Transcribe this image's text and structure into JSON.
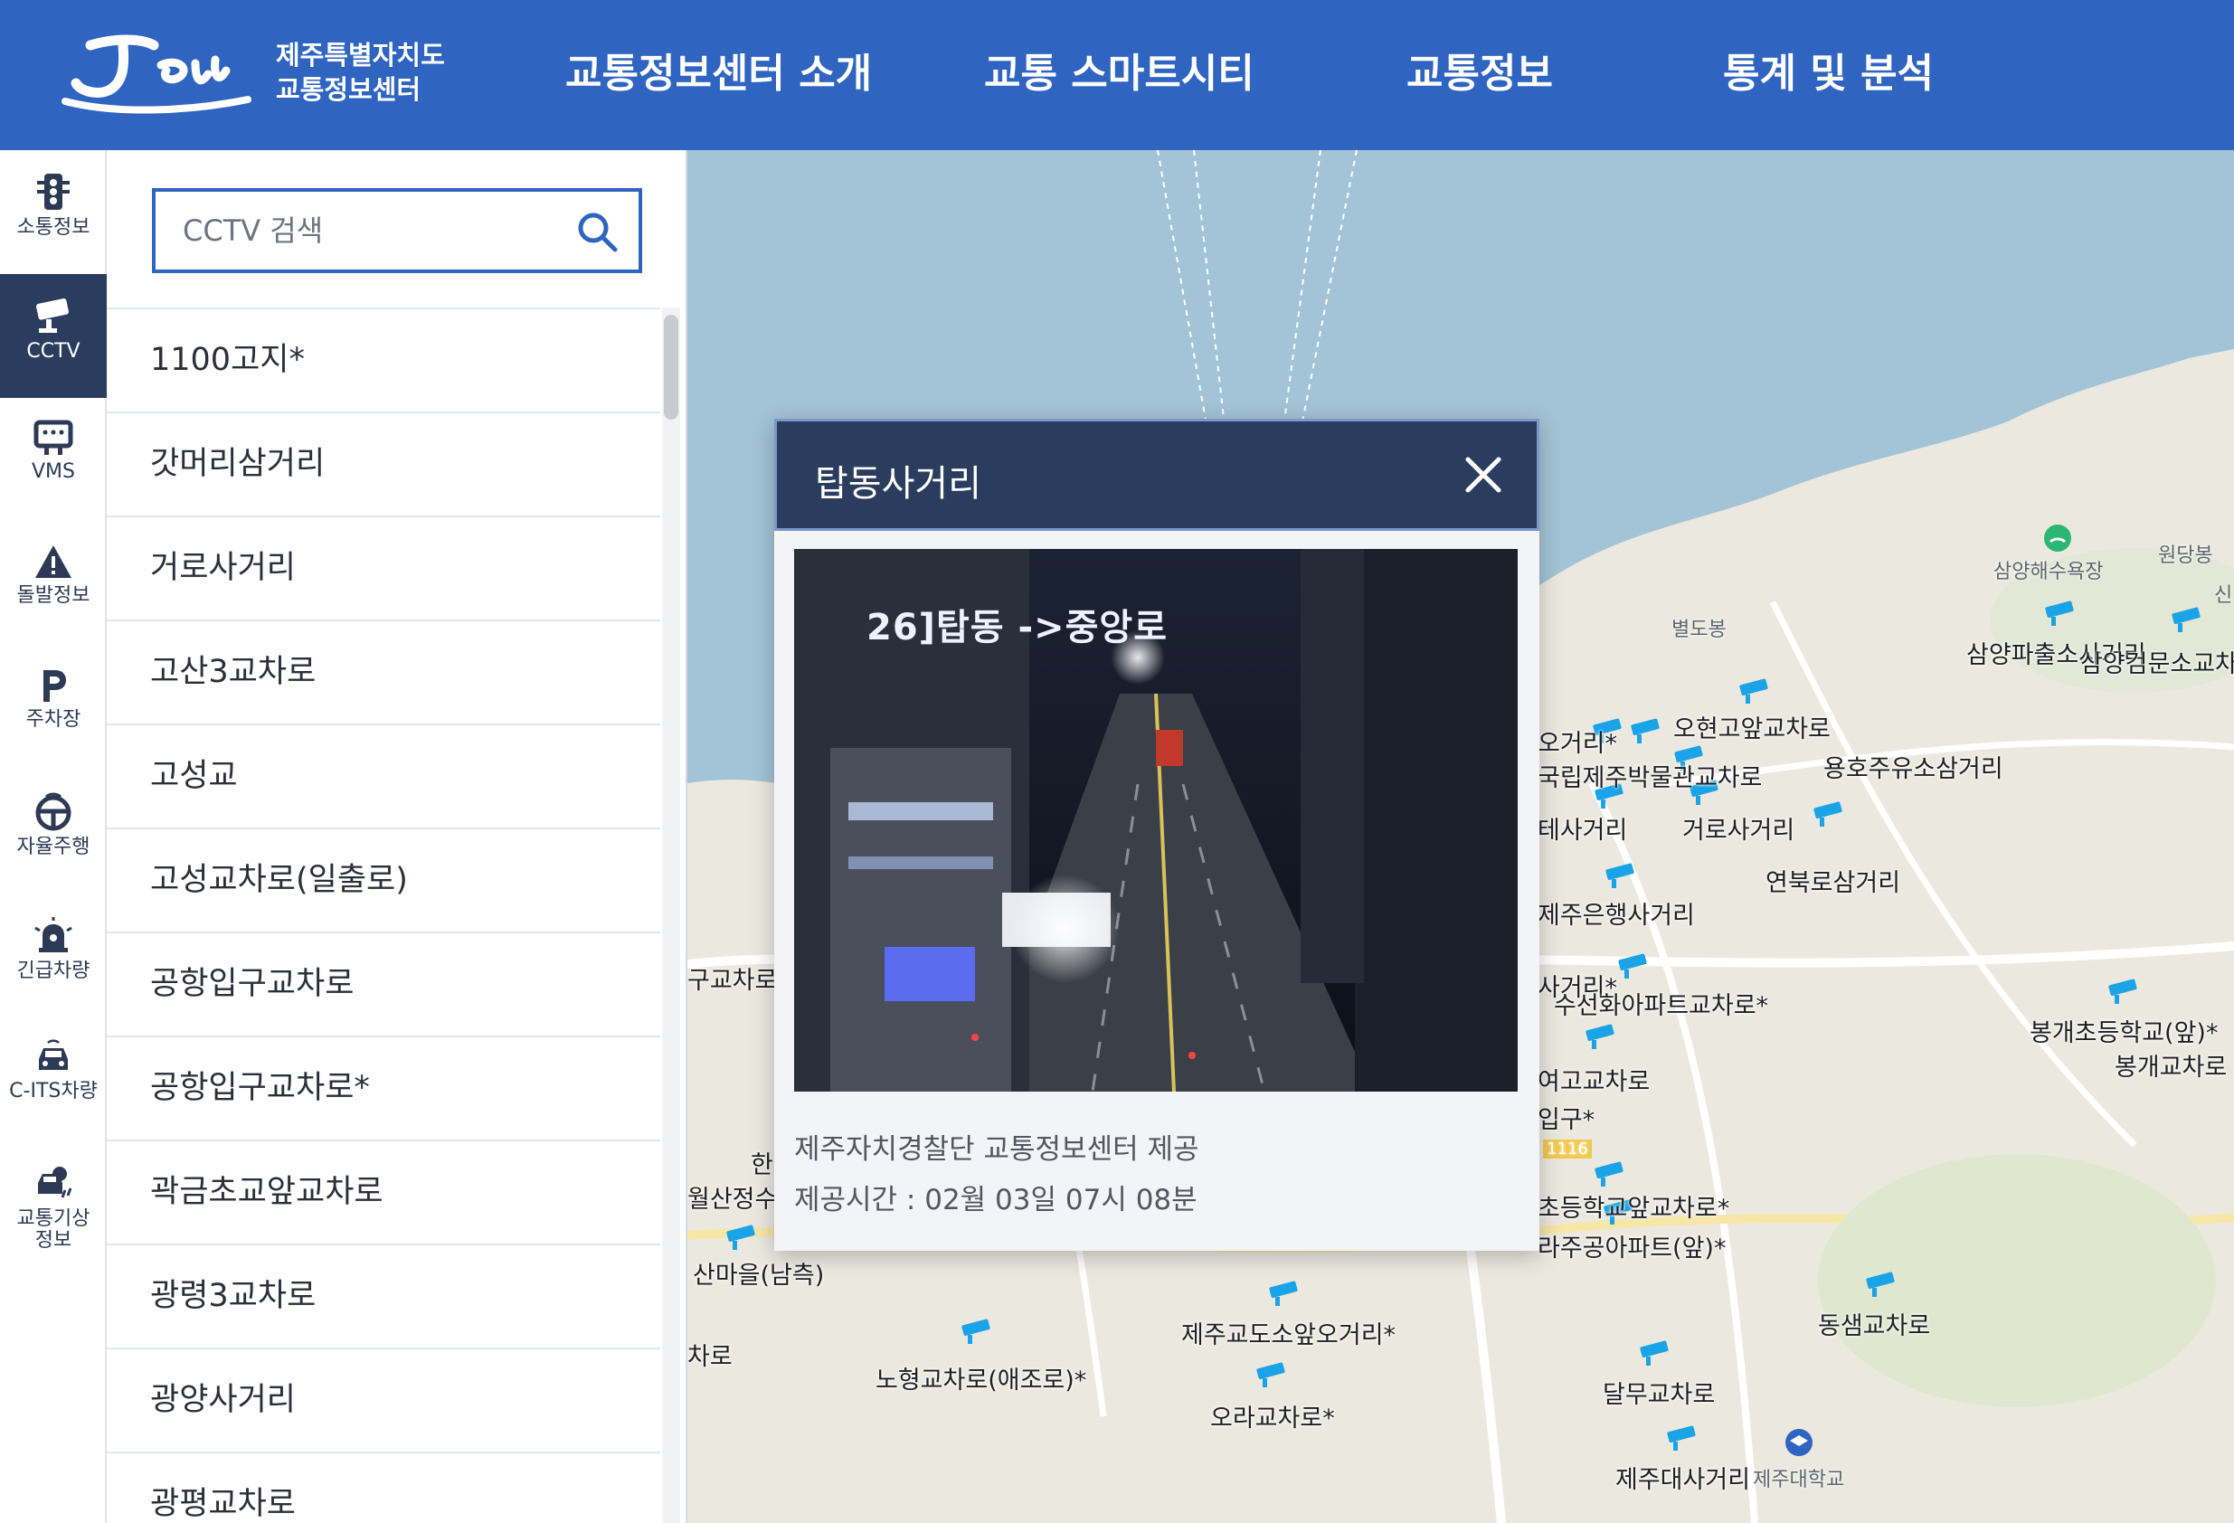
{
  "header": {
    "logo_text": "Jeju",
    "org_line1": "제주특별자치도",
    "org_line2": "교통정보센터",
    "nav": [
      "교통정보센터 소개",
      "교통 스마트시티",
      "교통정보",
      "통계 및 분석"
    ],
    "bg_color": "#2f64c0"
  },
  "rail": {
    "items": [
      {
        "label": "소통정보",
        "icon": "traffic-light-icon"
      },
      {
        "label": "CCTV",
        "icon": "cctv-icon",
        "active": true
      },
      {
        "label": "VMS",
        "icon": "vms-sign-icon"
      },
      {
        "label": "돌발정보",
        "icon": "warning-icon"
      },
      {
        "label": "주차장",
        "icon": "parking-icon"
      },
      {
        "label": "자율주행",
        "icon": "steering-wheel-icon"
      },
      {
        "label": "긴급차량",
        "icon": "siren-icon"
      },
      {
        "label": "C-ITS차량",
        "icon": "car-icon"
      },
      {
        "label": "교통기상",
        "label2": "정보",
        "icon": "weather-icon"
      }
    ],
    "active_color": "#2b3d5e"
  },
  "panel": {
    "search_placeholder": "CCTV 검색",
    "list": [
      "1100고지*",
      "갓머리삼거리",
      "거로사거리",
      "고산3교차로",
      "고성교",
      "고성교차로(일출로)",
      "공항입구교차로",
      "공항입구교차로*",
      "곽금초교앞교차로",
      "광령3교차로",
      "광양사거리",
      "광평교차로"
    ]
  },
  "map": {
    "labels": [
      "삼양해수욕장",
      "원당봉",
      "신",
      "별도봉",
      "삼양파출소사거리",
      "삼양검문소교차",
      "오거리*",
      "오현고앞교차로",
      "국립제주박물관교차로",
      "용호주유소삼거리",
      "테사거리",
      "거로사거리",
      "연북로삼거리",
      "제주은행사거리",
      "구교차로",
      "사거리*",
      "수선화아파트교차로*",
      "봉개초등학교(앞)*",
      "봉개교차로",
      "여고교차로",
      "입구*",
      "한",
      "월산정수",
      "초등학교앞교차로*",
      "라주공아파트(앞)*",
      "산마을(남측)",
      "동샘교차로",
      "제주교도소앞오거리*",
      "차로",
      "노형교차로(애조로)*",
      "달무교차로",
      "오라교차로*",
      "제주대사거리",
      "제주대학교",
      "1116"
    ],
    "water_color": "#9fc2d5",
    "land_color": "#ebe9df"
  },
  "popup": {
    "title": "탑동사거리",
    "feed_caption": "26]탑동 ->중앙로",
    "provider": "제주자치경찰단 교통정보센터 제공",
    "time": "제공시간 : 02월 03일 07시 08분",
    "header_color": "#2b3d5e"
  }
}
